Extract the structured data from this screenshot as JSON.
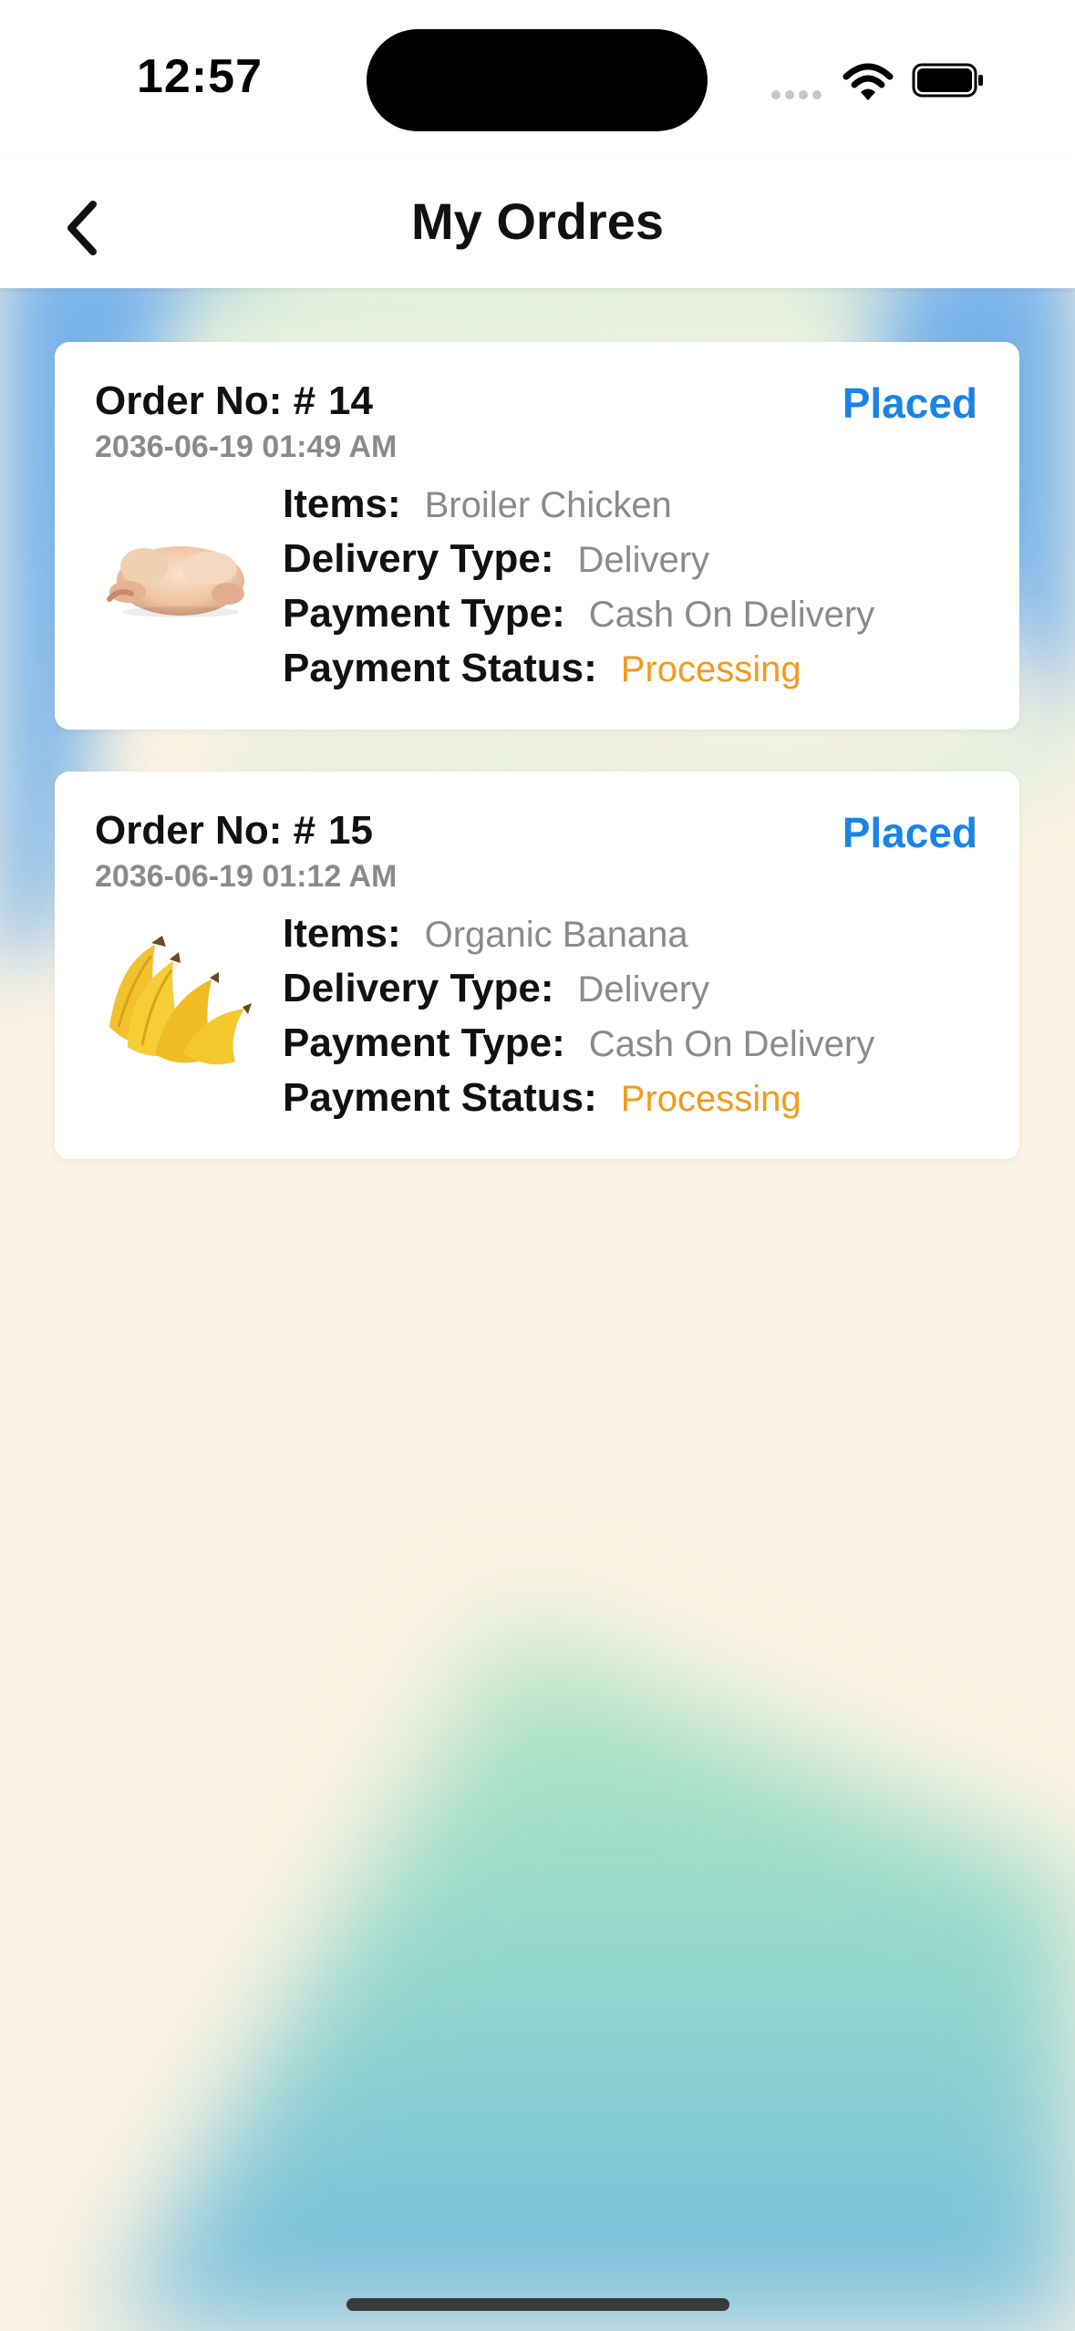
{
  "status_bar": {
    "time": "12:57",
    "signal_icon": "signal-dots-icon",
    "wifi_icon": "wifi-icon",
    "battery_icon": "battery-full-icon"
  },
  "nav": {
    "back_icon": "chevron-left-icon",
    "title": "My Ordres"
  },
  "labels": {
    "order_no": "Order No: #",
    "items": "Items:",
    "delivery_type": "Delivery Type:",
    "payment_type": "Payment Type:",
    "payment_status": "Payment Status:"
  },
  "orders": [
    {
      "number": "14",
      "status": "Placed",
      "date": "2036-06-19 01:49 AM",
      "items": "Broiler Chicken",
      "delivery_type": "Delivery",
      "payment_type": "Cash On Delivery",
      "payment_status": "Processing",
      "image_icon": "chicken-image"
    },
    {
      "number": "15",
      "status": "Placed",
      "date": "2036-06-19 01:12 AM",
      "items": "Organic Banana",
      "delivery_type": "Delivery",
      "payment_type": "Cash On Delivery",
      "payment_status": "Processing",
      "image_icon": "banana-image"
    }
  ],
  "colors": {
    "status_placed": "#1a84e6",
    "payment_processing": "#f39a1c",
    "background": "#fbf3e3"
  }
}
